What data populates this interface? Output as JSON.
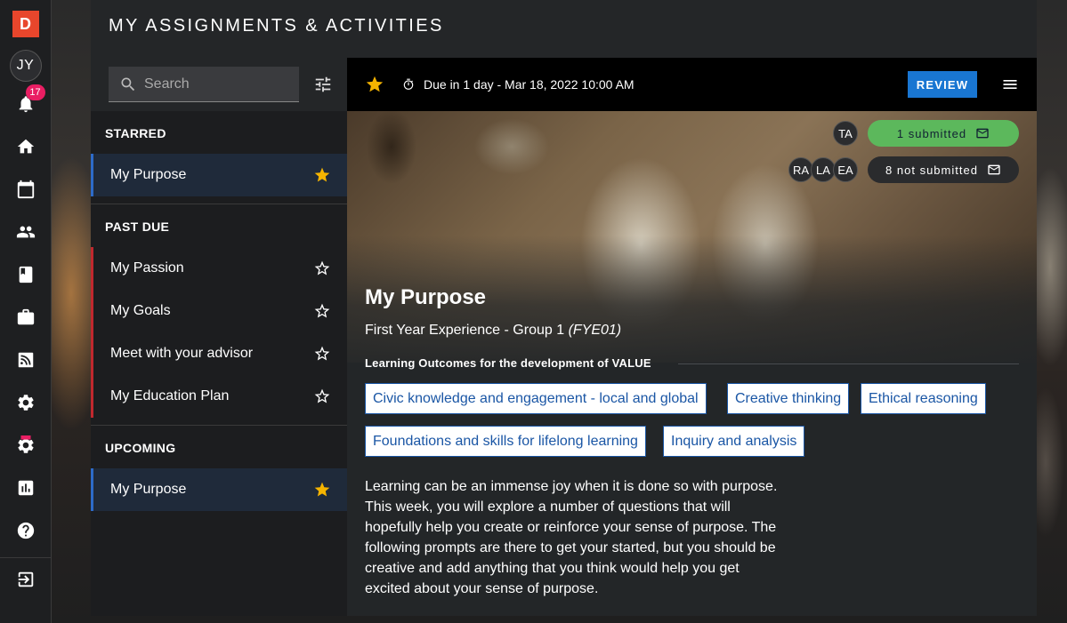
{
  "app": {
    "logo_letter": "D",
    "user_initials": "JY",
    "notification_count": "17"
  },
  "header": {
    "title": "MY ASSIGNMENTS & ACTIVITIES"
  },
  "search": {
    "placeholder": "Search",
    "value": ""
  },
  "sections": {
    "starred": {
      "label": "STARRED",
      "items": [
        {
          "label": "My Purpose",
          "starred": true
        }
      ]
    },
    "past_due": {
      "label": "PAST DUE",
      "items": [
        {
          "label": "My Passion",
          "starred": false
        },
        {
          "label": "My Goals",
          "starred": false
        },
        {
          "label": "Meet with your advisor",
          "starred": false
        },
        {
          "label": "My Education Plan",
          "starred": false
        }
      ]
    },
    "upcoming": {
      "label": "UPCOMING",
      "items": [
        {
          "label": "My Purpose",
          "starred": true
        }
      ]
    }
  },
  "detail": {
    "due_text": "Due in 1 day - Mar 18, 2022 10:00 AM",
    "review_label": "REVIEW",
    "submitted_avatars": [
      "TA"
    ],
    "submitted_label": "1 submitted",
    "not_submitted_avatars": [
      "RA",
      "LA",
      "EA"
    ],
    "not_submitted_label": "8 not submitted",
    "title": "My Purpose",
    "course": "First Year Experience - Group 1",
    "course_code": "(FYE01)",
    "outcomes_heading": "Learning Outcomes for the development of VALUE",
    "outcomes": [
      "Civic knowledge and engagement - local and global",
      "Creative thinking",
      "Ethical reasoning",
      "Foundations and skills for lifelong learning",
      "Inquiry and analysis"
    ],
    "description": "Learning can be an immense joy when it is done so with purpose. This week, you will explore a number of questions that will hopefully help you create or reinforce your sense of purpose. The following prompts are there to get your started, but you should be creative and add anything that you think would help you get excited about your sense of purpose."
  },
  "colors": {
    "accent": "#1976d2",
    "star": "#f5b400",
    "past_due": "#c0282e",
    "submitted": "#5cb85c",
    "badge": "#e91e63",
    "logo": "#e8462c"
  },
  "icons": {
    "rail": [
      "bell-icon",
      "home-icon",
      "calendar-icon",
      "people-icon",
      "book-icon",
      "briefcase-icon",
      "feed-icon",
      "settings-icon",
      "beta-settings-icon",
      "chart-icon",
      "help-icon",
      "logout-icon"
    ]
  }
}
